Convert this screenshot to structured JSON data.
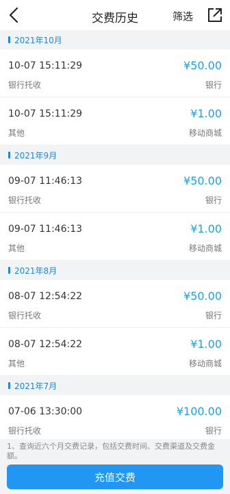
{
  "header": {
    "title": "交费历史",
    "filter_label": "筛选"
  },
  "months": [
    {
      "label": "2021年10月",
      "records": [
        {
          "datetime": "10-07 15:11:29",
          "amount": "¥50.00",
          "type": "银行托收",
          "channel": "银行"
        },
        {
          "datetime": "10-07 15:11:29",
          "amount": "¥1.00",
          "type": "其他",
          "channel": "移动商城"
        }
      ]
    },
    {
      "label": "2021年9月",
      "records": [
        {
          "datetime": "09-07 11:46:13",
          "amount": "¥50.00",
          "type": "银行托收",
          "channel": "银行"
        },
        {
          "datetime": "09-07 11:46:13",
          "amount": "¥1.00",
          "type": "其他",
          "channel": "移动商城"
        }
      ]
    },
    {
      "label": "2021年8月",
      "records": [
        {
          "datetime": "08-07 12:54:22",
          "amount": "¥50.00",
          "type": "银行托收",
          "channel": "银行"
        },
        {
          "datetime": "08-07 12:54:22",
          "amount": "¥1.00",
          "type": "其他",
          "channel": "移动商城"
        }
      ]
    },
    {
      "label": "2021年7月",
      "records": [
        {
          "datetime": "07-06 13:30:00",
          "amount": "¥100.00",
          "type": "银行托收",
          "channel": "银行"
        }
      ]
    }
  ],
  "footnote": "1、查询近六个月交费记录，包括交费时间、交费渠道及交费金额。",
  "charge_button": "充值交费",
  "colors": {
    "accent": "#2196f3",
    "amount": "#1ea0e6",
    "month_header": "#1e88d6"
  },
  "icons": {
    "back": "chevron-left-icon",
    "share": "share-out-icon"
  }
}
